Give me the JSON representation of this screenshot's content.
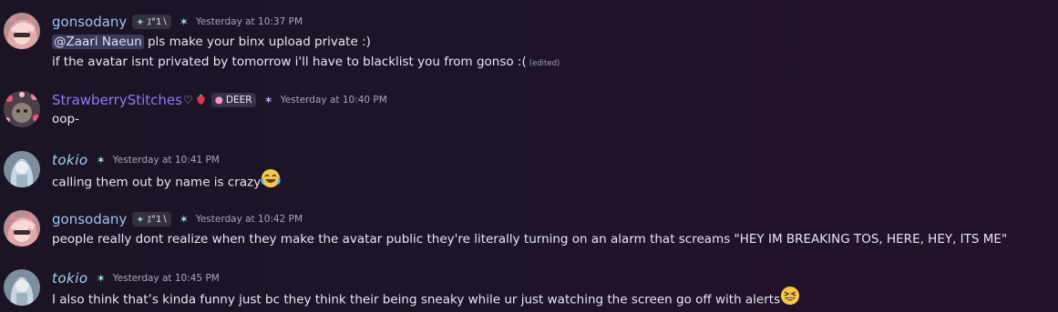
{
  "messages": [
    {
      "author": "gonsodany",
      "tag": "⁄’°1∖",
      "tag_text": "⁒°1∖",
      "star_icon": "star-icon",
      "timestamp": "Yesterday at 10:37 PM",
      "lines": {
        "mention": "@Zaari Naeun",
        "line1_rest": " pls make your binx upload private :)",
        "line2": "if the avatar isnt privated by tomorrow i'll have to blacklist you from gonso :(",
        "edited": "(edited)"
      }
    },
    {
      "author": "StrawberryStitches",
      "heart": "♡",
      "berry": "●",
      "badge": "DEER",
      "timestamp": "Yesterday at 10:40 PM",
      "lines": {
        "line1": "oop-"
      }
    },
    {
      "author": "tokio",
      "timestamp": "Yesterday at 10:41 PM",
      "lines": {
        "line1": "calling them out by name is crazy"
      }
    },
    {
      "author": "gonsodany",
      "timestamp": "Yesterday at 10:42 PM",
      "lines": {
        "line1": "people really dont realize when they  make the avatar public they're literally turning on an alarm that screams \"HEY IM BREAKING TOS, HERE, HEY, ITS ME\""
      }
    },
    {
      "author": "tokio",
      "timestamp": "Yesterday at 10:45 PM",
      "lines": {
        "line1": "I also think that’s kinda funny just bc they think their being sneaky while ur just watching the screen go off with alerts"
      }
    }
  ],
  "colors": {
    "gonso_name": "#9fc3f0",
    "straw_name": "#8f7cf5",
    "tokio_name": "#a5d4f6",
    "teal_star": "#9ee7ea",
    "violet_star": "#c5a6fb"
  },
  "icons": {
    "tag": "clan-tag-icon",
    "star": "star-icon",
    "laugh_cry": "laughing-crying-emoji",
    "grin_squint": "grinning-squinting-emoji"
  }
}
